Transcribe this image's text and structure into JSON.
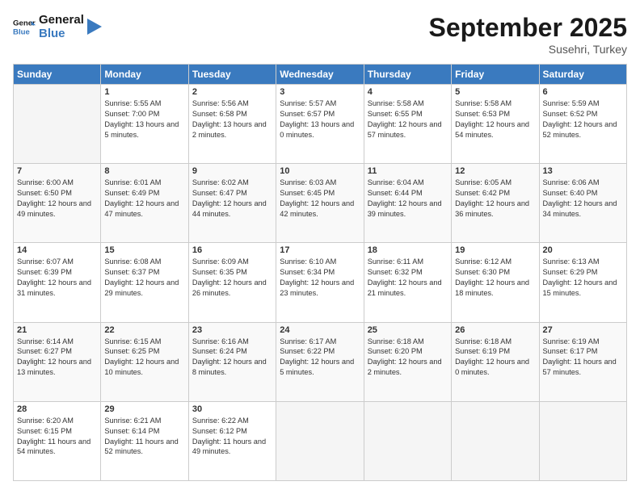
{
  "header": {
    "logo_line1": "General",
    "logo_line2": "Blue",
    "month": "September 2025",
    "location": "Susehri, Turkey"
  },
  "weekdays": [
    "Sunday",
    "Monday",
    "Tuesday",
    "Wednesday",
    "Thursday",
    "Friday",
    "Saturday"
  ],
  "weeks": [
    [
      {
        "day": "",
        "sunrise": "",
        "sunset": "",
        "daylight": ""
      },
      {
        "day": "1",
        "sunrise": "Sunrise: 5:55 AM",
        "sunset": "Sunset: 7:00 PM",
        "daylight": "Daylight: 13 hours and 5 minutes."
      },
      {
        "day": "2",
        "sunrise": "Sunrise: 5:56 AM",
        "sunset": "Sunset: 6:58 PM",
        "daylight": "Daylight: 13 hours and 2 minutes."
      },
      {
        "day": "3",
        "sunrise": "Sunrise: 5:57 AM",
        "sunset": "Sunset: 6:57 PM",
        "daylight": "Daylight: 13 hours and 0 minutes."
      },
      {
        "day": "4",
        "sunrise": "Sunrise: 5:58 AM",
        "sunset": "Sunset: 6:55 PM",
        "daylight": "Daylight: 12 hours and 57 minutes."
      },
      {
        "day": "5",
        "sunrise": "Sunrise: 5:58 AM",
        "sunset": "Sunset: 6:53 PM",
        "daylight": "Daylight: 12 hours and 54 minutes."
      },
      {
        "day": "6",
        "sunrise": "Sunrise: 5:59 AM",
        "sunset": "Sunset: 6:52 PM",
        "daylight": "Daylight: 12 hours and 52 minutes."
      }
    ],
    [
      {
        "day": "7",
        "sunrise": "Sunrise: 6:00 AM",
        "sunset": "Sunset: 6:50 PM",
        "daylight": "Daylight: 12 hours and 49 minutes."
      },
      {
        "day": "8",
        "sunrise": "Sunrise: 6:01 AM",
        "sunset": "Sunset: 6:49 PM",
        "daylight": "Daylight: 12 hours and 47 minutes."
      },
      {
        "day": "9",
        "sunrise": "Sunrise: 6:02 AM",
        "sunset": "Sunset: 6:47 PM",
        "daylight": "Daylight: 12 hours and 44 minutes."
      },
      {
        "day": "10",
        "sunrise": "Sunrise: 6:03 AM",
        "sunset": "Sunset: 6:45 PM",
        "daylight": "Daylight: 12 hours and 42 minutes."
      },
      {
        "day": "11",
        "sunrise": "Sunrise: 6:04 AM",
        "sunset": "Sunset: 6:44 PM",
        "daylight": "Daylight: 12 hours and 39 minutes."
      },
      {
        "day": "12",
        "sunrise": "Sunrise: 6:05 AM",
        "sunset": "Sunset: 6:42 PM",
        "daylight": "Daylight: 12 hours and 36 minutes."
      },
      {
        "day": "13",
        "sunrise": "Sunrise: 6:06 AM",
        "sunset": "Sunset: 6:40 PM",
        "daylight": "Daylight: 12 hours and 34 minutes."
      }
    ],
    [
      {
        "day": "14",
        "sunrise": "Sunrise: 6:07 AM",
        "sunset": "Sunset: 6:39 PM",
        "daylight": "Daylight: 12 hours and 31 minutes."
      },
      {
        "day": "15",
        "sunrise": "Sunrise: 6:08 AM",
        "sunset": "Sunset: 6:37 PM",
        "daylight": "Daylight: 12 hours and 29 minutes."
      },
      {
        "day": "16",
        "sunrise": "Sunrise: 6:09 AM",
        "sunset": "Sunset: 6:35 PM",
        "daylight": "Daylight: 12 hours and 26 minutes."
      },
      {
        "day": "17",
        "sunrise": "Sunrise: 6:10 AM",
        "sunset": "Sunset: 6:34 PM",
        "daylight": "Daylight: 12 hours and 23 minutes."
      },
      {
        "day": "18",
        "sunrise": "Sunrise: 6:11 AM",
        "sunset": "Sunset: 6:32 PM",
        "daylight": "Daylight: 12 hours and 21 minutes."
      },
      {
        "day": "19",
        "sunrise": "Sunrise: 6:12 AM",
        "sunset": "Sunset: 6:30 PM",
        "daylight": "Daylight: 12 hours and 18 minutes."
      },
      {
        "day": "20",
        "sunrise": "Sunrise: 6:13 AM",
        "sunset": "Sunset: 6:29 PM",
        "daylight": "Daylight: 12 hours and 15 minutes."
      }
    ],
    [
      {
        "day": "21",
        "sunrise": "Sunrise: 6:14 AM",
        "sunset": "Sunset: 6:27 PM",
        "daylight": "Daylight: 12 hours and 13 minutes."
      },
      {
        "day": "22",
        "sunrise": "Sunrise: 6:15 AM",
        "sunset": "Sunset: 6:25 PM",
        "daylight": "Daylight: 12 hours and 10 minutes."
      },
      {
        "day": "23",
        "sunrise": "Sunrise: 6:16 AM",
        "sunset": "Sunset: 6:24 PM",
        "daylight": "Daylight: 12 hours and 8 minutes."
      },
      {
        "day": "24",
        "sunrise": "Sunrise: 6:17 AM",
        "sunset": "Sunset: 6:22 PM",
        "daylight": "Daylight: 12 hours and 5 minutes."
      },
      {
        "day": "25",
        "sunrise": "Sunrise: 6:18 AM",
        "sunset": "Sunset: 6:20 PM",
        "daylight": "Daylight: 12 hours and 2 minutes."
      },
      {
        "day": "26",
        "sunrise": "Sunrise: 6:18 AM",
        "sunset": "Sunset: 6:19 PM",
        "daylight": "Daylight: 12 hours and 0 minutes."
      },
      {
        "day": "27",
        "sunrise": "Sunrise: 6:19 AM",
        "sunset": "Sunset: 6:17 PM",
        "daylight": "Daylight: 11 hours and 57 minutes."
      }
    ],
    [
      {
        "day": "28",
        "sunrise": "Sunrise: 6:20 AM",
        "sunset": "Sunset: 6:15 PM",
        "daylight": "Daylight: 11 hours and 54 minutes."
      },
      {
        "day": "29",
        "sunrise": "Sunrise: 6:21 AM",
        "sunset": "Sunset: 6:14 PM",
        "daylight": "Daylight: 11 hours and 52 minutes."
      },
      {
        "day": "30",
        "sunrise": "Sunrise: 6:22 AM",
        "sunset": "Sunset: 6:12 PM",
        "daylight": "Daylight: 11 hours and 49 minutes."
      },
      {
        "day": "",
        "sunrise": "",
        "sunset": "",
        "daylight": ""
      },
      {
        "day": "",
        "sunrise": "",
        "sunset": "",
        "daylight": ""
      },
      {
        "day": "",
        "sunrise": "",
        "sunset": "",
        "daylight": ""
      },
      {
        "day": "",
        "sunrise": "",
        "sunset": "",
        "daylight": ""
      }
    ]
  ]
}
